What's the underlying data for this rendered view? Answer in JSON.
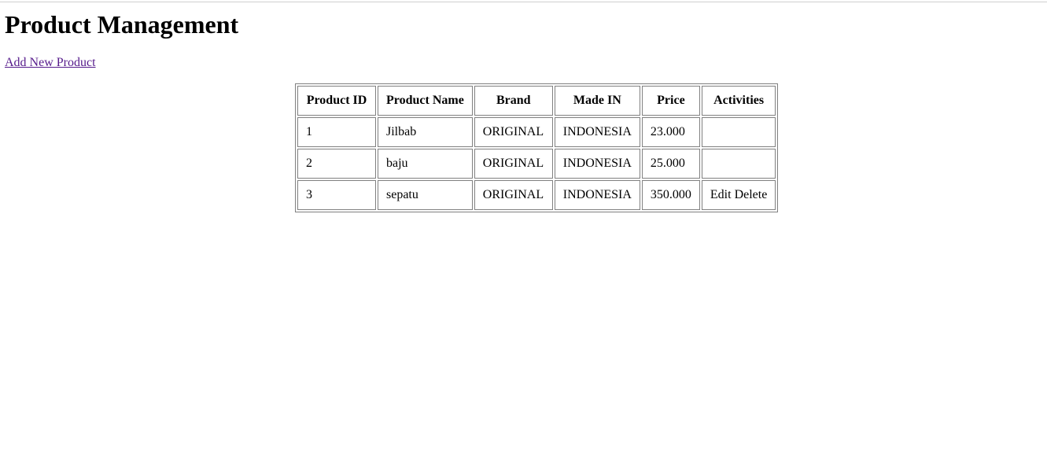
{
  "page": {
    "title": "Product Management",
    "add_link": "Add New Product"
  },
  "table": {
    "headers": {
      "id": "Product ID",
      "name": "Product Name",
      "brand": "Brand",
      "made_in": "Made IN",
      "price": "Price",
      "activities": "Activities"
    },
    "rows": [
      {
        "id": "1",
        "name": "Jilbab",
        "brand": "ORIGINAL",
        "made_in": "INDONESIA",
        "price": "23.000",
        "edit": "",
        "delete": ""
      },
      {
        "id": "2",
        "name": "baju",
        "brand": "ORIGINAL",
        "made_in": "INDONESIA",
        "price": "25.000",
        "edit": "",
        "delete": ""
      },
      {
        "id": "3",
        "name": "sepatu",
        "brand": "ORIGINAL",
        "made_in": "INDONESIA",
        "price": "350.000",
        "edit": "Edit",
        "delete": "Delete"
      }
    ]
  }
}
